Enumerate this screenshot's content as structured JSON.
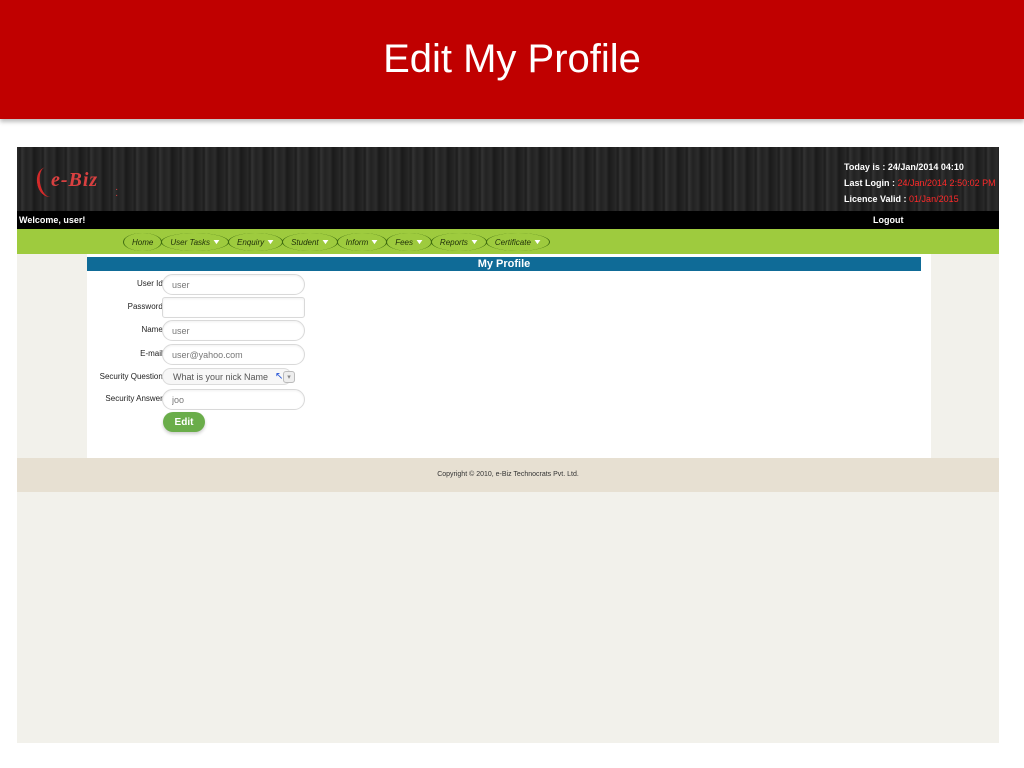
{
  "slide": {
    "title": "Edit My Profile"
  },
  "colors": {
    "slide_title_bg": "#c00000",
    "nav_bg": "#9ecb3e",
    "section_header_bg": "#0f6b97",
    "button_bg": "#6aad4a",
    "highlight_red": "#ff2a2a",
    "footer_bg": "#e7e0d2"
  },
  "header": {
    "logo_text": "e-Biz",
    "logo_icon": "ebiz-logo-icon",
    "today_label": "Today is :",
    "today_value": "24/Jan/2014 04:10",
    "last_login_label": "Last Login :",
    "last_login_value": "24/Jan/2014 2:50:02 PM",
    "licence_label": "Licence Valid :",
    "licence_value": "01/Jan/2015"
  },
  "welcome_bar": {
    "welcome_text": "Welcome,  user!",
    "logout_label": "Logout"
  },
  "nav": {
    "items": [
      {
        "label": "Home",
        "has_dropdown": false
      },
      {
        "label": "User Tasks",
        "has_dropdown": true
      },
      {
        "label": "Enquiry",
        "has_dropdown": true
      },
      {
        "label": "Student",
        "has_dropdown": true
      },
      {
        "label": "Inform",
        "has_dropdown": true
      },
      {
        "label": "Fees",
        "has_dropdown": true
      },
      {
        "label": "Reports",
        "has_dropdown": true
      },
      {
        "label": "Certificate",
        "has_dropdown": true
      }
    ],
    "dropdown_icon": "chevron-down-icon"
  },
  "profile": {
    "section_title": "My Profile",
    "fields": {
      "user_id": {
        "label": "User Id:",
        "value": "user"
      },
      "password": {
        "label": "Password:",
        "value": ""
      },
      "name": {
        "label": "Name:",
        "value": "user"
      },
      "email": {
        "label": "E-mail:",
        "value": "user@yahoo.com"
      },
      "security_question": {
        "label": "Security Question:",
        "value": "What is your nick Name"
      },
      "security_answer": {
        "label": "Security Answer:",
        "value": "joo"
      }
    },
    "edit_label": "Edit"
  },
  "footer": {
    "copyright": "Copyright © 2010, e-Biz Technocrats Pvt. Ltd."
  }
}
